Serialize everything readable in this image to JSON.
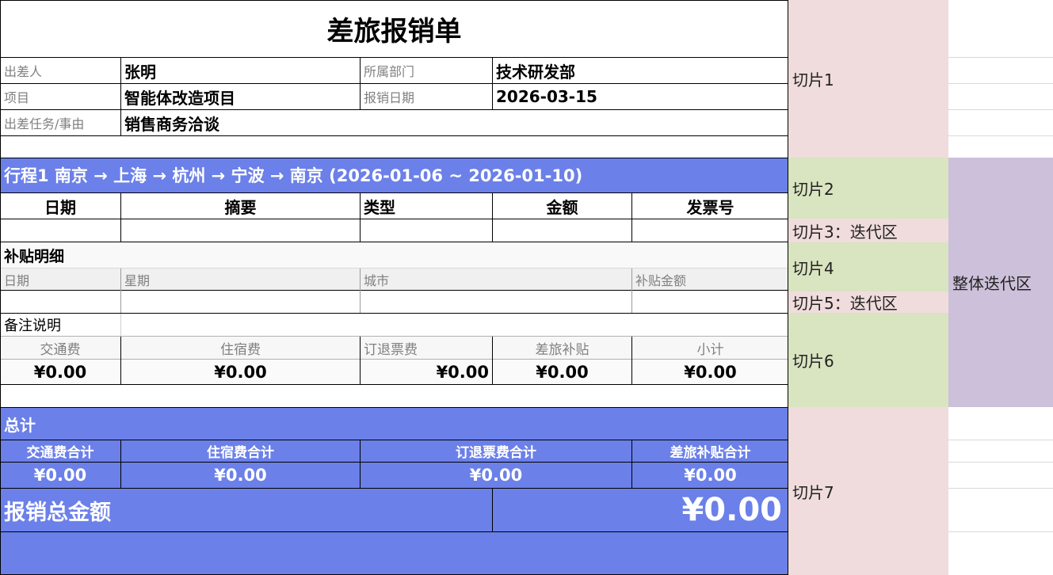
{
  "form": {
    "title": "差旅报销单",
    "traveler_label": "出差人",
    "traveler_value": "张明",
    "department_label": "所属部门",
    "department_value": "技术研发部",
    "project_label": "项目",
    "project_value": "智能体改造项目",
    "date_label": "报销日期",
    "date_value": "2026-03-15",
    "task_label": "出差任务/事由",
    "task_value": "销售商务洽谈"
  },
  "trip": {
    "header": "行程1  南京 → 上海 → 杭州 → 宁波 → 南京  (2026-01-06 ~ 2026-01-10)",
    "columns": [
      "日期",
      "摘要",
      "类型",
      "金额",
      "发票号"
    ],
    "subsidy_title": "补贴明细",
    "subsidy_columns": [
      "日期",
      "星期",
      "城市",
      "补贴金额"
    ],
    "note_label": "备注说明",
    "subtotal_labels": [
      "交通费",
      "住宿费",
      "订退票费",
      "差旅补贴",
      "小计"
    ],
    "subtotal_values": [
      "¥0.00",
      "¥0.00",
      "¥0.00",
      "¥0.00",
      "¥0.00"
    ]
  },
  "total": {
    "title": "总计",
    "labels": [
      "交通费合计",
      "住宿费合计",
      "订退票费合计",
      "差旅补贴合计"
    ],
    "values": [
      "¥0.00",
      "¥0.00",
      "¥0.00",
      "¥0.00"
    ],
    "grand_label": "报销总金额",
    "grand_value": "¥0.00"
  },
  "slices": {
    "s1": "切片1",
    "s2": "切片2",
    "s3": "切片3：迭代区",
    "s4": "切片4",
    "s5": "切片5：迭代区",
    "s6": "切片6",
    "s7": "切片7",
    "whole": "整体迭代区"
  },
  "colors": {
    "blue": "#6b80e8",
    "pink": "#f0dcdc",
    "green": "#d9e4c0",
    "purple": "#cdc0da"
  }
}
